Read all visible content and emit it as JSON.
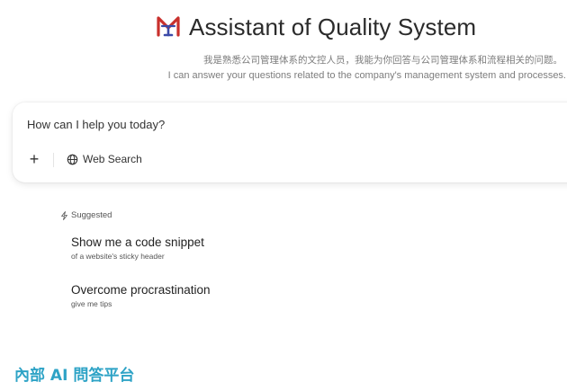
{
  "header": {
    "title": "Assistant of Quality System",
    "logo_colors": {
      "primary": "#c9302c",
      "secondary": "#3b4aa8"
    }
  },
  "description": {
    "zh": "我是熟悉公司管理体系的文控人员，我能为你回答与公司管理体系和流程相关的问题。",
    "en": "I can answer your questions related to the company's management system and processes."
  },
  "chat": {
    "placeholder": "How can I help you today?",
    "add_label": "+",
    "web_search_label": "Web Search"
  },
  "suggested": {
    "label": "Suggested",
    "items": [
      {
        "title": "Show me a code snippet",
        "subtitle": "of a website's sticky header"
      },
      {
        "title": "Overcome procrastination",
        "subtitle": "give me tips"
      }
    ]
  },
  "footer": {
    "title": "內部 AI 問答平台",
    "color": "#2ea3c6"
  }
}
